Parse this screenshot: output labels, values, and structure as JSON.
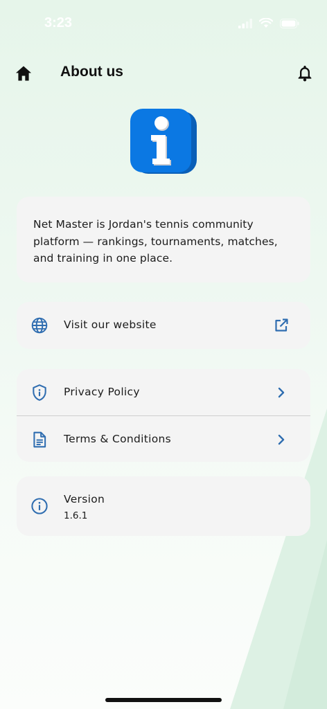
{
  "status_bar": {
    "time": "3:23"
  },
  "header": {
    "title": "About us",
    "home_icon": "home-icon",
    "bell_icon": "bell-icon"
  },
  "logo": {
    "icon": "info-logo-icon"
  },
  "about": {
    "description": "Net Master is Jordan's tennis community platform — rankings, tournaments, matches, and training in one place."
  },
  "links": {
    "website": {
      "label": "Visit our website",
      "icon": "globe-icon",
      "trailing_icon": "external-link-icon"
    },
    "privacy": {
      "label": "Privacy Policy",
      "icon": "shield-info-icon",
      "trailing_icon": "chevron-right-icon"
    },
    "terms": {
      "label": "Terms & Conditions",
      "icon": "document-icon",
      "trailing_icon": "chevron-right-icon"
    }
  },
  "version": {
    "label": "Version",
    "value": "1.6.1",
    "icon": "info-circle-icon"
  },
  "colors": {
    "accent": "#2f6db0",
    "logo_blue": "#0b78e3",
    "card_bg": "#f4f4f4"
  }
}
